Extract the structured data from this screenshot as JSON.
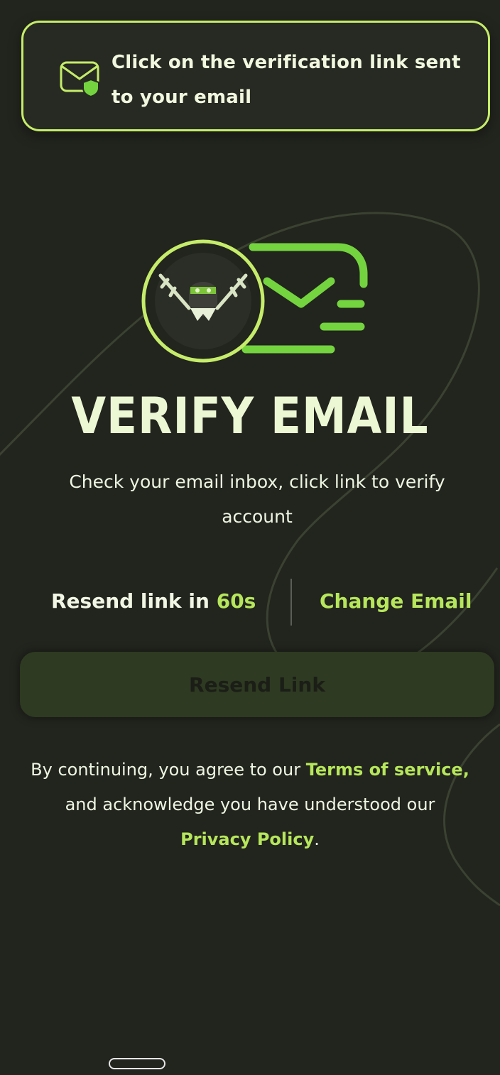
{
  "toast": {
    "message": "Click on the verification link sent to your email",
    "icon": "mail-shield-icon"
  },
  "hero": {
    "avatar_icon": "ninja-avatar-icon",
    "envelope_icon": "fast-mail-icon"
  },
  "page": {
    "title": "VERIFY EMAIL",
    "subtitle": "Check your email inbox, click link to verify account"
  },
  "actions": {
    "resend_prefix": "Resend link in ",
    "resend_countdown": "60s",
    "change_email": "Change Email"
  },
  "button": {
    "resend_label": "Resend Link",
    "disabled": true
  },
  "legal": {
    "line_prefix": "By continuing, you agree to our ",
    "terms_link": "Terms of service,",
    "line_middle": " and acknowledge you have understood our ",
    "privacy_link": "Privacy Policy",
    "line_suffix": "."
  },
  "colors": {
    "background": "#22241e",
    "accent": "#b6e65b",
    "toast_border": "#c5ec6a",
    "hero_green": "#74d43f",
    "title": "#ecf7d4"
  }
}
